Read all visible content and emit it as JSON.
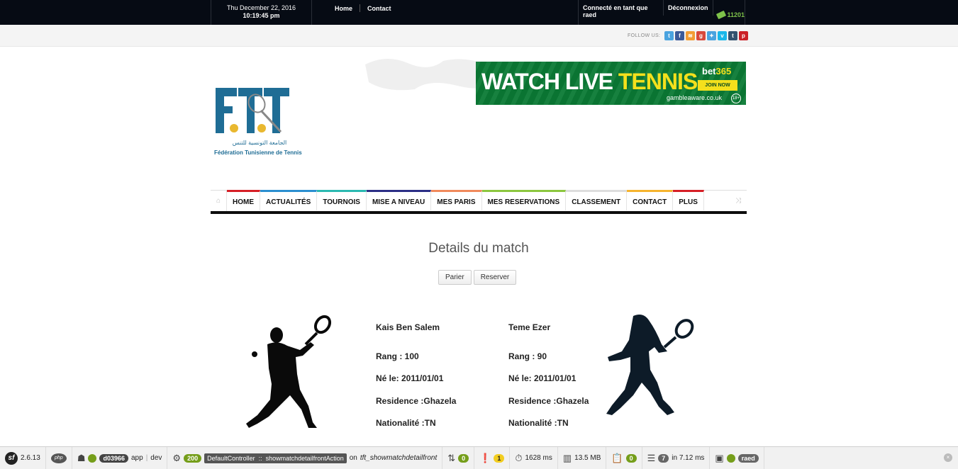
{
  "topbar": {
    "date": "Thu December 22, 2016",
    "time": "10:19:45 pm",
    "links": [
      "Home",
      "Contact"
    ],
    "connected": "Connecté en tant que raed",
    "logout": "Déconnexion",
    "points": "11201"
  },
  "follow": {
    "label": "FOLLOW US:",
    "icons": [
      {
        "name": "twitter-icon",
        "glyph": "t",
        "color": "#4aa3df"
      },
      {
        "name": "facebook-icon",
        "glyph": "f",
        "color": "#3b5998"
      },
      {
        "name": "rss-icon",
        "glyph": "≋",
        "color": "#f39c33"
      },
      {
        "name": "googleplus-icon",
        "glyph": "g",
        "color": "#d8493b"
      },
      {
        "name": "tumblr-icon",
        "glyph": "✦",
        "color": "#4aa3df"
      },
      {
        "name": "vimeo-icon",
        "glyph": "v",
        "color": "#1ab7ea"
      },
      {
        "name": "tumblr-t-icon",
        "glyph": "t",
        "color": "#34526f"
      },
      {
        "name": "pinterest-icon",
        "glyph": "p",
        "color": "#cb2027"
      }
    ]
  },
  "logo": {
    "arabic": "الجامعة التونسية للتنس",
    "french": "Fédération Tunisienne de Tennis"
  },
  "banner": {
    "headline_a": "WATCH LIVE ",
    "headline_b": "TENNIS",
    "brand_a": "bet",
    "brand_b": "365",
    "join": "JOIN NOW",
    "gamble": "gambleaware.co.uk",
    "age": "18+"
  },
  "nav": {
    "items": [
      {
        "label": "HOME",
        "color": "#d61f26"
      },
      {
        "label": "ACTUALITÉS",
        "color": "#2b8fd0"
      },
      {
        "label": "TOURNOIS",
        "color": "#2bb9b1"
      },
      {
        "label": "MISE A NIVEAU",
        "color": "#2c2f86"
      },
      {
        "label": "MES PARIS",
        "color": "#f08a5c"
      },
      {
        "label": "MES RESERVATIONS",
        "color": "#8cc63f"
      },
      {
        "label": "CLASSEMENT",
        "color": "#ddd"
      },
      {
        "label": "CONTACT",
        "color": "#f6b42e"
      },
      {
        "label": "PLUS",
        "color": "#d61f26"
      }
    ]
  },
  "match": {
    "title": "Details du match",
    "bet_button": "Parier",
    "reserve_button": "Reserver",
    "player1": {
      "name": "Kais Ben Salem",
      "rank": "Rang : 100",
      "born": "Né le: 2011/01/01",
      "residence": "Residence :Ghazela",
      "nationality": "Nationalité :TN"
    },
    "player2": {
      "name": "Teme Ezer",
      "rank": "Rang : 90",
      "born": "Né le: 2011/01/01",
      "residence": "Residence :Ghazela",
      "nationality": "Nationalité :TN"
    }
  },
  "toolbar": {
    "version": "2.6.13",
    "php": "php",
    "token": "d03966",
    "env_app": "app",
    "env_dev": "dev",
    "status": "200",
    "controller": "DefaultController",
    "action": "showmatchdetailfrontAction",
    "route_prefix": "on",
    "route": "tft_showmatchdetailfront",
    "ajax": "0",
    "errors": "1",
    "time": "1628 ms",
    "memory": "13.5 MB",
    "forms": "0",
    "queries": "7",
    "query_time": "in 7.12 ms",
    "user": "raed"
  }
}
